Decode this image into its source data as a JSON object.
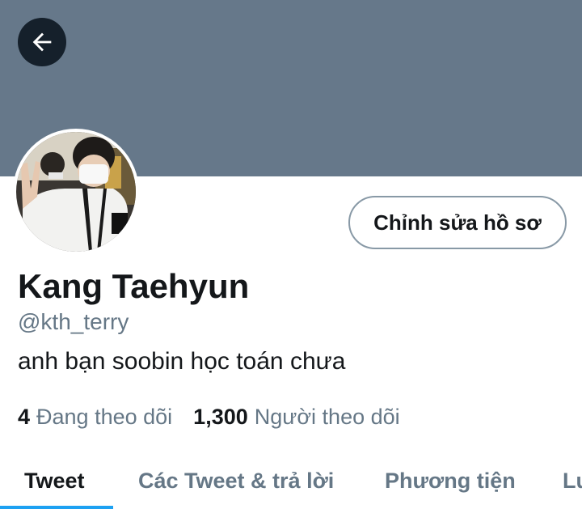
{
  "header": {
    "back_icon": "arrow-left-icon",
    "banner_color": "#66788a"
  },
  "profile": {
    "name": "Kang Taehyun",
    "handle": "@kth_terry",
    "bio": "anh bạn soobin học toán chưa",
    "edit_button_label": "Chỉnh sửa hồ sơ"
  },
  "stats": {
    "following": {
      "count": "4",
      "label": "Đang theo dõi"
    },
    "followers": {
      "count": "1,300",
      "label": "Người theo dõi"
    }
  },
  "tabs": [
    {
      "label": "Tweet",
      "active": true
    },
    {
      "label": "Các Tweet & trả lời",
      "active": false
    },
    {
      "label": "Phương tiện",
      "active": false
    },
    {
      "label": "Lu",
      "active": false
    }
  ],
  "colors": {
    "accent": "#1da1f2",
    "text_primary": "#14171a",
    "text_secondary": "#657786"
  }
}
